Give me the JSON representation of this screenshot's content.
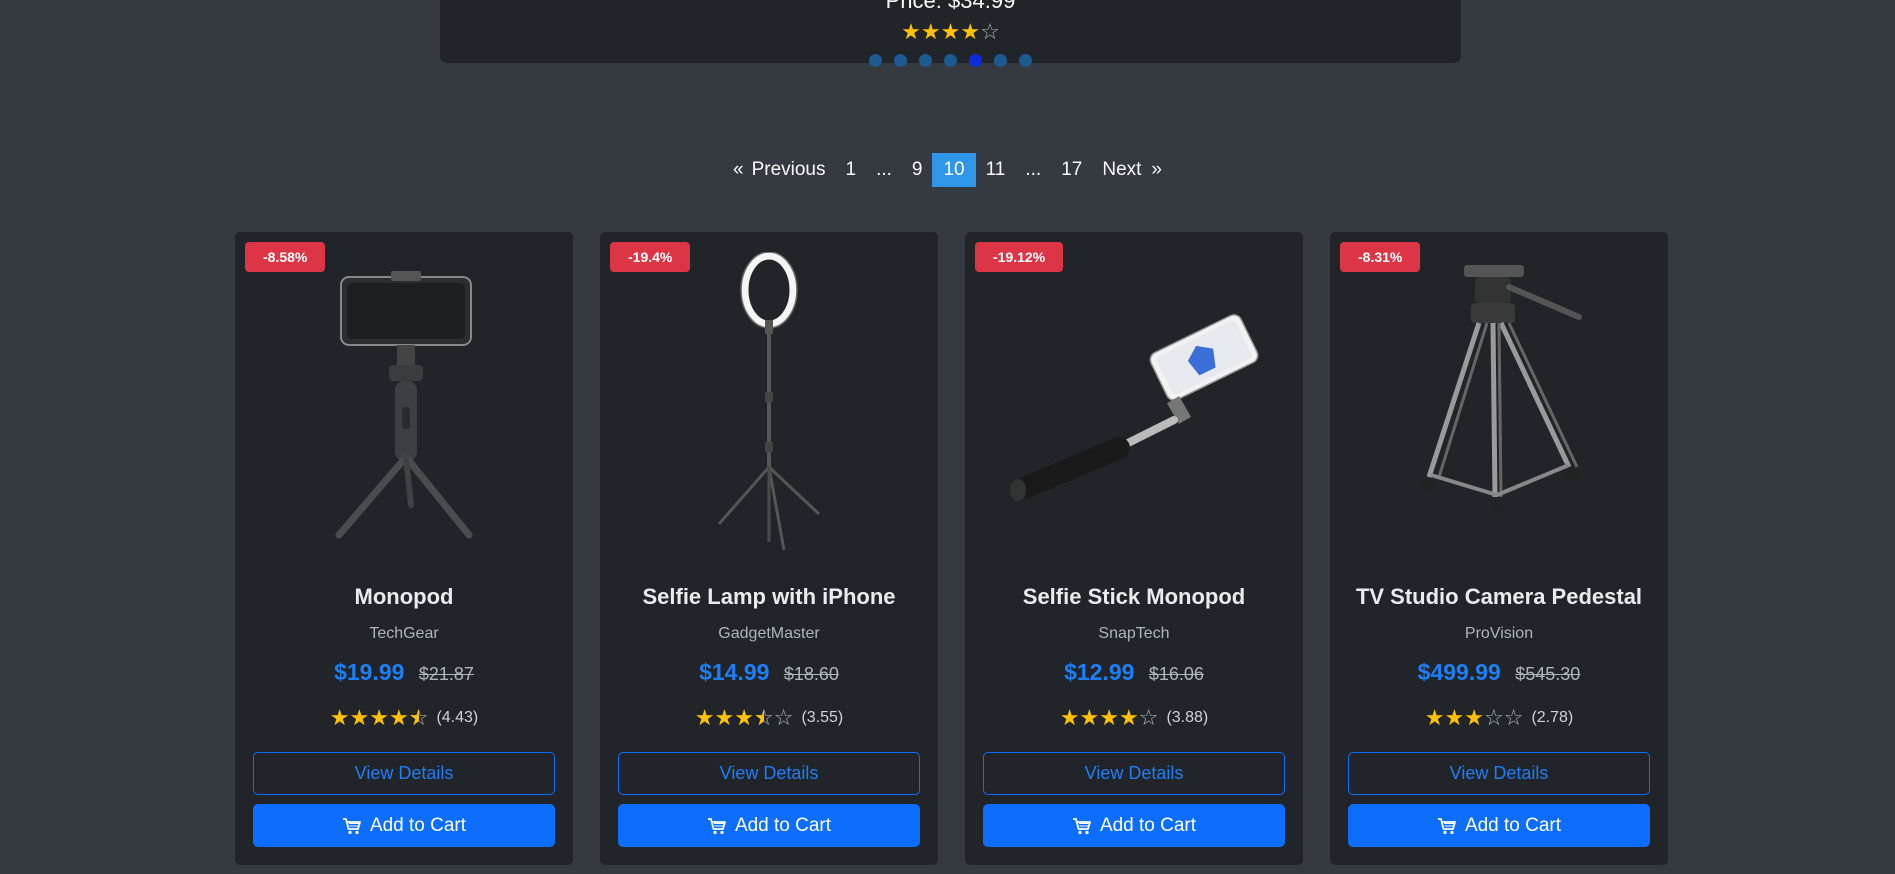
{
  "carousel": {
    "price_text": "Price: $34.99",
    "rating": 4,
    "dot_count": 7,
    "active_dot": 5
  },
  "pagination": {
    "items": [
      "«",
      "Previous",
      "1",
      "...",
      "9",
      "10",
      "11",
      "...",
      "17",
      "Next",
      "»"
    ],
    "active": "10"
  },
  "products": [
    {
      "discount": "-8.58%",
      "name": "Monopod",
      "brand": "TechGear",
      "price": "$19.99",
      "old_price": "$21.87",
      "rating": 4.43,
      "rating_text": "(4.43)",
      "image_icon": "tripod-phone-mount-icon"
    },
    {
      "discount": "-19.4%",
      "name": "Selfie Lamp with iPhone",
      "brand": "GadgetMaster",
      "price": "$14.99",
      "old_price": "$18.60",
      "rating": 3.55,
      "rating_text": "(3.55)",
      "image_icon": "ring-light-stand-icon"
    },
    {
      "discount": "-19.12%",
      "name": "Selfie Stick Monopod",
      "brand": "SnapTech",
      "price": "$12.99",
      "old_price": "$16.06",
      "rating": 3.88,
      "rating_text": "(3.88)",
      "image_icon": "selfie-stick-icon"
    },
    {
      "discount": "-8.31%",
      "name": "TV Studio Camera Pedestal",
      "brand": "ProVision",
      "price": "$499.99",
      "old_price": "$545.30",
      "rating": 2.78,
      "rating_text": "(2.78)",
      "image_icon": "camera-tripod-icon"
    }
  ],
  "buttons": {
    "view_details": "View Details",
    "add_to_cart": "Add to Cart"
  },
  "colors": {
    "background": "#343a40",
    "card": "#212529",
    "accent": "#0d6efd",
    "badge": "#dc3545",
    "star": "#ffc107"
  }
}
